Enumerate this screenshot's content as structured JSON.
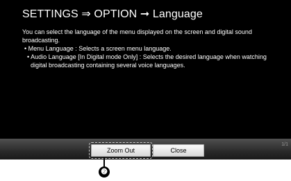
{
  "title": "SETTINGS ⇒ OPTION ➞ Language",
  "body": {
    "intro": "You can select the language of the menu displayed on the screen and digital sound broadcasting.",
    "bullet1": "• Menu Language : Selects a screen menu language.",
    "bullet2": "• Audio Language [In Digital mode Only] : Selects the desired language when watching digital broadcasting containing several voice languages."
  },
  "page_indicator": "1/1",
  "buttons": {
    "zoom_out": "Zoom Out",
    "close": "Close"
  },
  "callout_number": "❷"
}
